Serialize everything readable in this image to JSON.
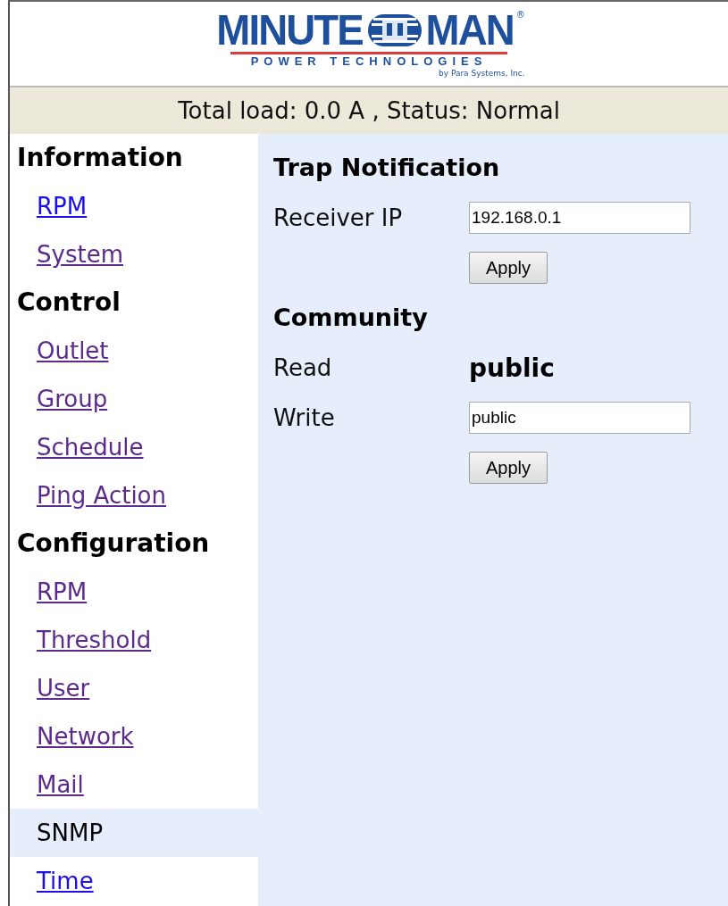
{
  "logo": {
    "word_left": "MINUTE",
    "word_right": "MAN",
    "registered": "®",
    "tagline": "POWER TECHNOLOGIES",
    "byline": "by Para Systems, Inc."
  },
  "status_bar": {
    "text": "Total load: 0.0 A , Status: Normal"
  },
  "sidebar": {
    "items": [
      {
        "kind": "heading",
        "label": "Information"
      },
      {
        "kind": "link",
        "label": "RPM",
        "visited": false,
        "selected": false
      },
      {
        "kind": "link",
        "label": "System",
        "visited": true,
        "selected": false
      },
      {
        "kind": "heading",
        "label": "Control"
      },
      {
        "kind": "link",
        "label": "Outlet",
        "visited": true,
        "selected": false
      },
      {
        "kind": "link",
        "label": "Group",
        "visited": true,
        "selected": false
      },
      {
        "kind": "link",
        "label": "Schedule",
        "visited": true,
        "selected": false
      },
      {
        "kind": "link",
        "label": "Ping Action",
        "visited": true,
        "selected": false
      },
      {
        "kind": "heading",
        "label": "Configuration"
      },
      {
        "kind": "link",
        "label": "RPM",
        "visited": true,
        "selected": false
      },
      {
        "kind": "link",
        "label": "Threshold",
        "visited": true,
        "selected": false
      },
      {
        "kind": "link",
        "label": "User",
        "visited": true,
        "selected": false
      },
      {
        "kind": "link",
        "label": "Network",
        "visited": true,
        "selected": false
      },
      {
        "kind": "link",
        "label": "Mail",
        "visited": true,
        "selected": false
      },
      {
        "kind": "link",
        "label": "SNMP",
        "selected": true
      },
      {
        "kind": "link",
        "label": "Time",
        "visited": false,
        "selected": false
      }
    ]
  },
  "content": {
    "rows": [
      {
        "kind": "heading",
        "label": "Trap Notification"
      },
      {
        "kind": "input",
        "label": "Receiver IP",
        "value": "192.168.0.1"
      },
      {
        "kind": "button",
        "label": "Apply"
      },
      {
        "kind": "heading",
        "label": "Community"
      },
      {
        "kind": "value",
        "label": "Read",
        "value": "public"
      },
      {
        "kind": "input",
        "label": "Write",
        "value": "public"
      },
      {
        "kind": "button",
        "label": "Apply"
      }
    ]
  }
}
